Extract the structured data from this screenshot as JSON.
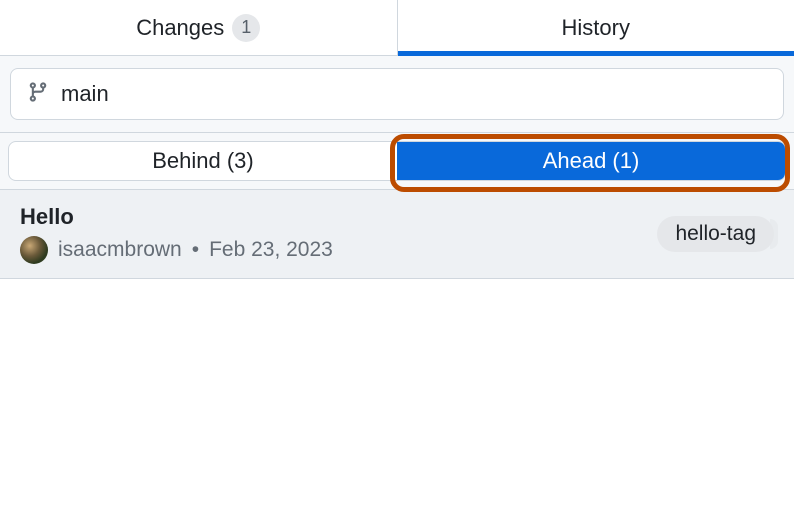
{
  "tabs": {
    "changes": {
      "label": "Changes",
      "count": "1"
    },
    "history": {
      "label": "History"
    }
  },
  "branch": {
    "name": "main"
  },
  "segments": {
    "behind": "Behind (3)",
    "ahead": "Ahead (1)"
  },
  "commits": [
    {
      "title": "Hello",
      "author": "isaacmbrown",
      "separator": "•",
      "date": "Feb 23, 2023",
      "tag": "hello-tag"
    }
  ],
  "colors": {
    "accent": "#0969da",
    "highlight": "#bc4c00"
  }
}
